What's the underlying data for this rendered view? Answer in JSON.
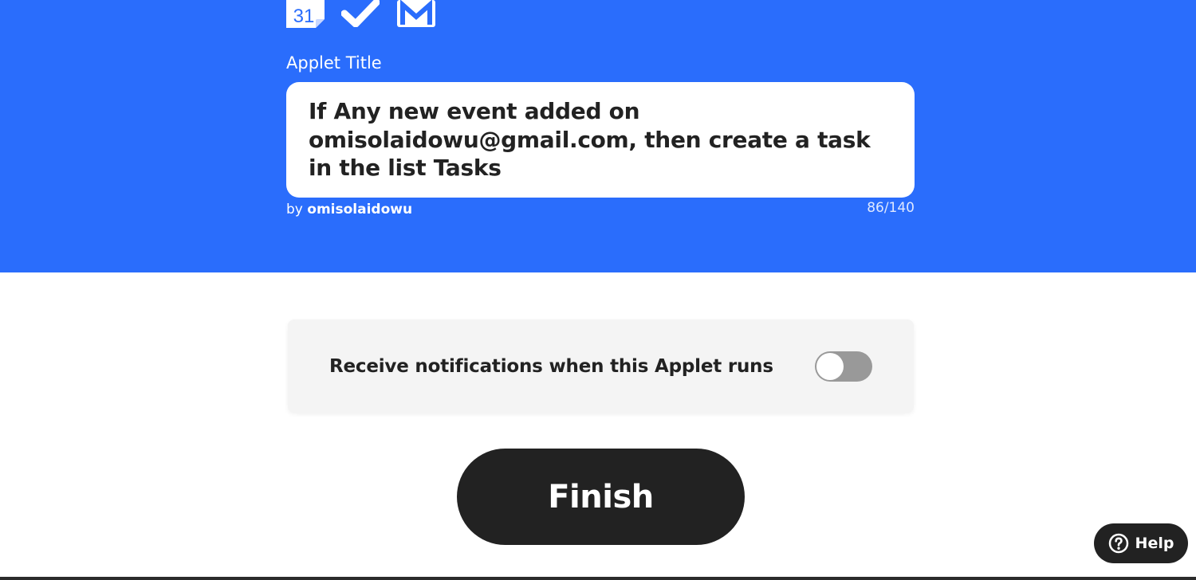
{
  "header": {
    "services": [
      {
        "name": "Google Calendar",
        "icon": "calendar-icon",
        "day": "31"
      },
      {
        "name": "Google Tasks",
        "icon": "checkmark-icon"
      },
      {
        "name": "Gmail",
        "icon": "gmail-icon"
      }
    ],
    "applet_title_label": "Applet Title",
    "applet_title_value": "If Any new event added on omisolaidowu@gmail.com, then create a task in the list Tasks",
    "by_prefix": "by",
    "author": "omisolaidowu",
    "char_count": "86/140"
  },
  "notifications": {
    "label": "Receive notifications when this Applet runs",
    "enabled": false
  },
  "finish_label": "Finish",
  "help_label": "Help",
  "colors": {
    "brand_blue": "#2a6dfc",
    "dark": "#222222",
    "toggle_off": "#999999",
    "card_bg": "#f4f4f4"
  }
}
